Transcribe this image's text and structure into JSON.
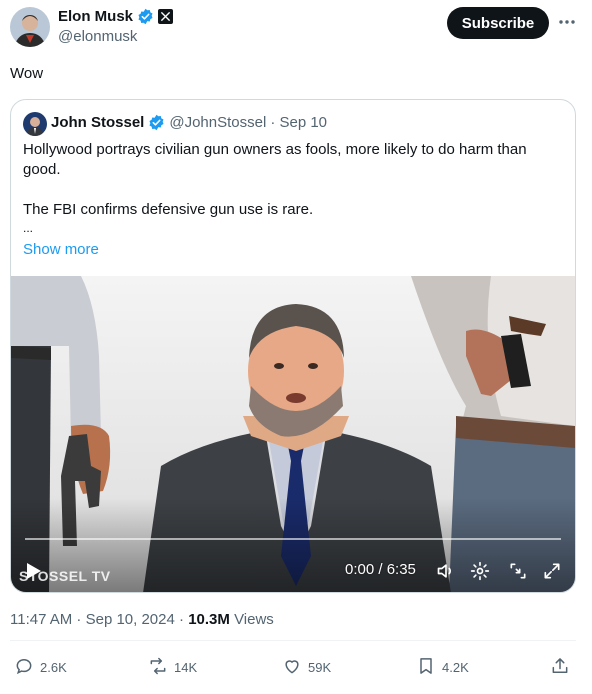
{
  "author": {
    "name": "Elon Musk",
    "handle": "@elonmusk"
  },
  "subscribe_label": "Subscribe",
  "tweet_text": "Wow",
  "quoted": {
    "name": "John Stossel",
    "handle": "@JohnStossel",
    "date": "· Sep 10",
    "text_line1": "Hollywood portrays civilian gun owners as fools, more likely to do harm than good.",
    "text_line2": "The FBI confirms defensive gun use is rare.",
    "text_line3": "...",
    "show_more": "Show more",
    "video": {
      "time": "0:00 / 6:35",
      "progress": 0,
      "watermark": "STOSSEL TV"
    }
  },
  "meta": {
    "time_date": "11:47 AM · Sep 10, 2024 ·",
    "views_count": "10.3M",
    "views_label": "Views"
  },
  "actions": {
    "replies": "2.6K",
    "reposts": "14K",
    "likes": "59K",
    "bookmarks": "4.2K"
  },
  "colors": {
    "text": "#0f1419",
    "secondary": "#536471",
    "link": "#1d9bf0",
    "verified": "#1d9bf0",
    "border": "#cfd9de"
  },
  "icons": [
    "verified-icon",
    "x-badge-icon",
    "more-icon",
    "play-icon",
    "volume-icon",
    "settings-icon",
    "pip-icon",
    "fullscreen-icon",
    "reply-icon",
    "repost-icon",
    "like-icon",
    "bookmark-icon",
    "share-icon"
  ]
}
